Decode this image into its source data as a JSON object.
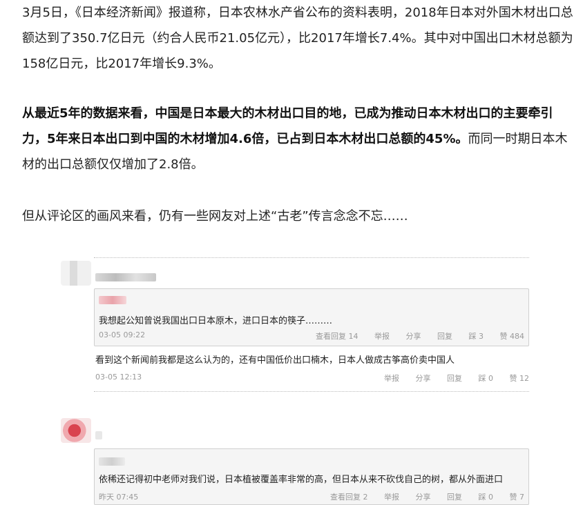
{
  "article": {
    "p1": "3月5日，《日本经济新闻》报道称，日本农林水产省公布的资料表明，2018年日本对外国木材出口总额达到了350.7亿日元（约合人民币21.05亿元），比2017年增长7.4%。其中对中国出口木材总额为158亿日元，比2017年增长9.3%。",
    "p2_bold": "从最近5年的数据来看，中国是日本最大的木材出口目的地，已成为推动日本木材出口的主要牵引力，5年来日本出口到中国的木材增加4.6倍，已占到日本木材出口总额的45%。",
    "p2_rest": "而同一时期日本木材的出口总额仅仅增加了2.8倍。",
    "p3": "但从评论区的画风来看，仍有一些网友对上述“古老”传言念念不忘……"
  },
  "comments": [
    {
      "quote": {
        "text": "我想起公知曾说我国出口日本原木，进口日本的筷子………",
        "time": "03-05 09:22",
        "view_replies": "查看回复 14",
        "report": "举报",
        "share": "分享",
        "reply": "回复",
        "dislike": "踩 3",
        "like": "赞 484"
      },
      "reply": {
        "text": "看到这个新闻前我都是这么认为的，还有中国低价出口楠木，日本人做成古筝高价卖中国人",
        "time": "03-05 12:13",
        "report": "举报",
        "share": "分享",
        "reply": "回复",
        "dislike": "踩 0",
        "like": "赞 12"
      }
    },
    {
      "quote": {
        "text": "依稀还记得初中老师对我们说，日本植被覆盖率非常的高，但日本从来不砍伐自己的树，都从外面进口",
        "time": "昨天 07:45",
        "view_replies": "查看回复 2",
        "report": "举报",
        "share": "分享",
        "reply": "回复",
        "dislike": "踩 0",
        "like": "赞 7"
      }
    }
  ]
}
